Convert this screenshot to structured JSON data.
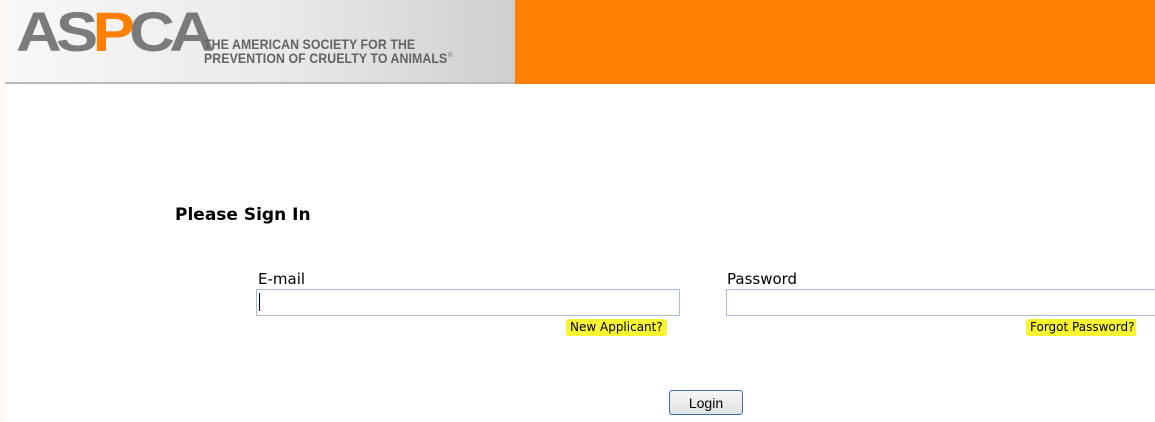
{
  "header": {
    "logo_text_1": "AS",
    "logo_text_2": "P",
    "logo_text_3": "CA",
    "logo_registered_mark": "®",
    "tagline_line_1": "THE AMERICAN SOCIETY FOR THE",
    "tagline_line_2": "PREVENTION OF CRUELTY TO ANIMALS",
    "tagline_registered_mark": "®",
    "colors": {
      "brand_orange": "#ff7f00",
      "logo_gray": "#7b7b7b"
    }
  },
  "signin": {
    "title": "Please Sign In",
    "email_label": "E-mail",
    "email_value": "",
    "password_label": "Password",
    "password_value": "",
    "new_applicant_link": "New Applicant?",
    "forgot_password_link": "Forgot Password?",
    "login_button": "Login",
    "highlight_color": "#f7f531"
  }
}
